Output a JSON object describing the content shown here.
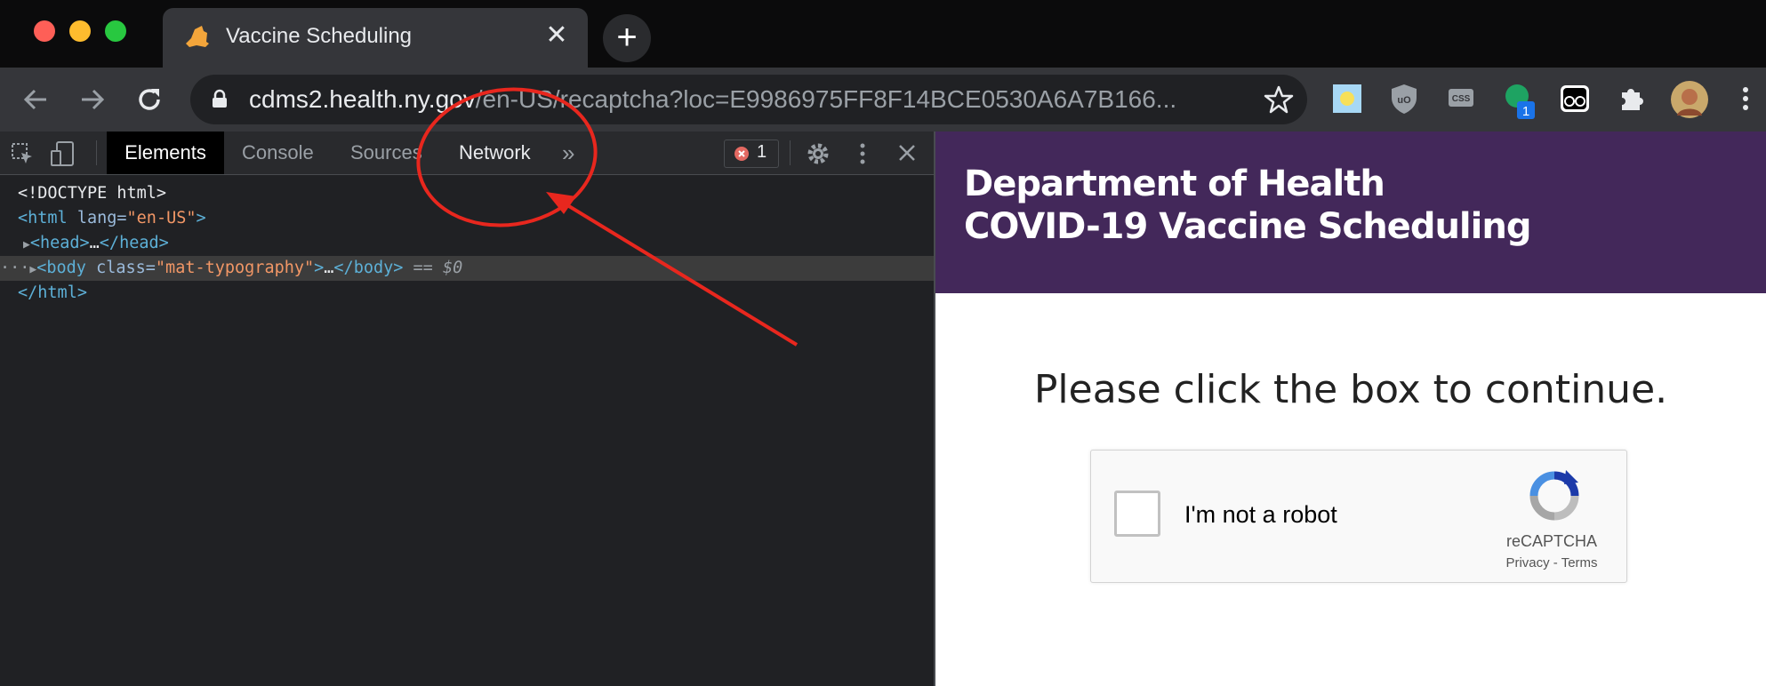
{
  "browser": {
    "tab": {
      "title": "Vaccine Scheduling"
    },
    "omnibox": {
      "host": "cdms2.health.ny.gov",
      "path": "/en-US/recaptcha?loc=E9986975FF8F14BCE0530A6A7B166..."
    },
    "extensions": [
      "weather-extension",
      "ublock-origin-extension",
      "css-extension",
      "green-status-extension",
      "roboform-extension",
      "puzzle-extensions-icon",
      "profile-avatar"
    ],
    "extension_badge": "1"
  },
  "devtools": {
    "tabs": [
      "Elements",
      "Console",
      "Sources",
      "Network"
    ],
    "active_tab": "Elements",
    "error_count": "1",
    "dom": {
      "doctype": "<!DOCTYPE html>",
      "html_open_tag": "<html",
      "html_lang_attr": " lang=",
      "html_lang_value": "\"en-US\"",
      "head": "<head>",
      "head_close": "</head>",
      "body_open": "<body",
      "body_class_attr": " class=",
      "body_class_value": "\"mat-typography\"",
      "body_close": "</body>",
      "html_close": "</html>",
      "ellipsis": "…",
      "selected_marker": "== $0",
      "gutter_dots": "···"
    }
  },
  "page": {
    "header_line1": "Department of Health",
    "header_line2": "COVID-19 Vaccine Scheduling",
    "prompt": "Please click the box to continue.",
    "captcha": {
      "label": "I'm not a robot",
      "brand": "reCAPTCHA",
      "privacy": "Privacy",
      "separator": " - ",
      "terms": "Terms"
    }
  },
  "colors": {
    "header_bg": "#43285a",
    "annotation": "#e8271e"
  }
}
